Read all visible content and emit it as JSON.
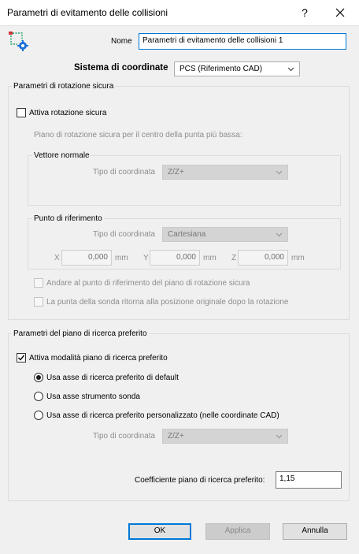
{
  "window": {
    "title": "Parametri di evitamento delle collisioni",
    "help_glyph": "?",
    "close_glyph": "✕"
  },
  "header": {
    "icon": "collision-params-icon",
    "name_label": "Nome",
    "name_value": "Parametri di evitamento delle collisioni 1",
    "coord_system_label": "Sistema di coordinate",
    "coord_system_value": "PCS (Riferimento CAD)"
  },
  "safe_rotation": {
    "group_title": "Parametri di rotazione sicura",
    "enable_label": "Attiva rotazione sicura",
    "enable_checked": false,
    "plane_desc": "Piano di rotazione sicura per il centro della punta più bassa:",
    "normal_vector": {
      "title": "Vettore normale",
      "coord_type_label": "Tipo di coordinata",
      "coord_type_value": "Z/Z+"
    },
    "reference_point": {
      "title": "Punto di riferimento",
      "coord_type_label": "Tipo di coordinata",
      "coord_type_value": "Cartesiana",
      "x_label": "X",
      "x_value": "0,000",
      "y_label": "Y",
      "y_value": "0,000",
      "z_label": "Z",
      "z_value": "0,000",
      "unit": "mm"
    },
    "goto_ref_label": "Andare al punto di riferimento del piano di rotazione sicura",
    "return_label": "La punta della sonda ritorna alla posizione originale dopo la rotazione"
  },
  "search_plane": {
    "group_title": "Parametri del piano di ricerca preferito",
    "enable_label": "Attiva modalità piano di ricerca preferito",
    "enable_checked": true,
    "radio_default": "Usa asse di ricerca preferito di default",
    "radio_tool": "Usa asse strumento sonda",
    "radio_custom": "Usa asse di ricerca preferito personalizzato (nelle coordinate CAD)",
    "selected_radio": "default",
    "coord_type_label": "Tipo di coordinata",
    "coord_type_value": "Z/Z+",
    "coefficient_label": "Coefficiente piano di ricerca preferito:",
    "coefficient_value": "1,15"
  },
  "footer": {
    "ok_label": "OK",
    "apply_label": "Applica",
    "cancel_label": "Annulla"
  },
  "colors": {
    "background": "#f0f0f0",
    "focus_border": "#0078d7",
    "disabled_text": "#8d8d8d"
  }
}
